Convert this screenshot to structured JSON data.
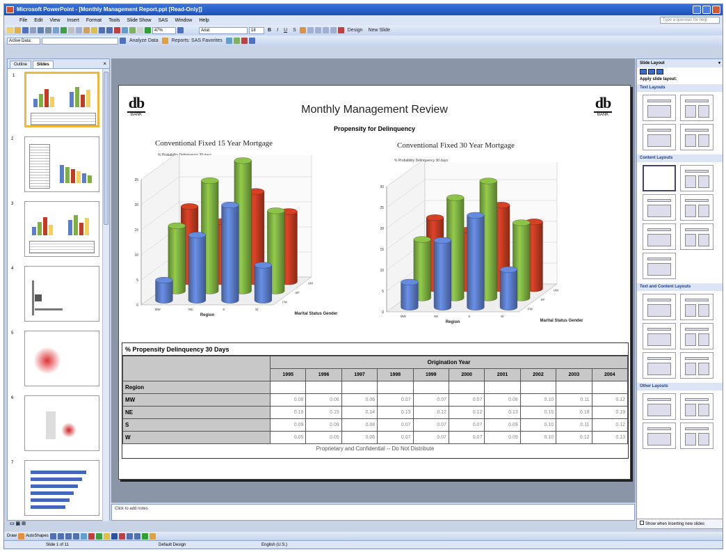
{
  "window": {
    "title": "Microsoft PowerPoint - [Monthly Management Report.ppt [Read-Only]]"
  },
  "menu": [
    "File",
    "Edit",
    "View",
    "Insert",
    "Format",
    "Tools",
    "Slide Show",
    "SAS",
    "Window",
    "Help"
  ],
  "help_box": "Type a question for help",
  "toolbar": {
    "zoom": "47%",
    "font": "Arial",
    "font_size": "18",
    "design_label": "Design",
    "new_slide_label": "New Slide",
    "active_data": "Active Data:",
    "analyze_label": "Analyze Data",
    "reports_label": "Reports: SAS Favorites"
  },
  "left_pane": {
    "tabs": [
      "Outline",
      "Slides"
    ],
    "thumb_numbers": [
      "1",
      "2",
      "3",
      "4",
      "5",
      "6",
      "7"
    ]
  },
  "slide": {
    "logo_text": "db",
    "logo_sub": "BANK",
    "title": "Monthly Management Review",
    "subtitle": "Propensity for Delinquency",
    "footer": "Proprietary and Confidential -- Do Not Distribute"
  },
  "colors": {
    "blue": "#5b7ec9",
    "green": "#7fb142",
    "red": "#c23b22",
    "yellow": "#f5cf5b"
  },
  "chart_data": [
    {
      "type": "bar3d-cylinder",
      "title": "Conventional Fixed 15 Year Mortgage",
      "ylabel": "% Probability Delinquency 30 days",
      "xlabel": "Region",
      "zlabel": "Marital Status Gender",
      "categories": [
        "MW",
        "NE",
        "S",
        "W"
      ],
      "depth_labels": [
        "FM",
        "SF",
        "UM"
      ],
      "y_ticks": [
        "0",
        "5",
        "10",
        "15",
        "20",
        "25"
      ],
      "ylim": [
        0,
        25
      ],
      "series": [
        {
          "values": [
            4,
            13,
            19,
            7
          ],
          "color": "blue"
        },
        {
          "values": [
            13,
            22,
            26,
            16
          ],
          "color": "green"
        },
        {
          "values": [
            15,
            12,
            18,
            14
          ],
          "color": "red"
        }
      ]
    },
    {
      "type": "bar3d-cylinder",
      "title": "Conventional Fixed 30 Year Mortgage",
      "ylabel": "% Probability Delinquency 30 days",
      "xlabel": "Region",
      "zlabel": "Marital Status Gender",
      "categories": [
        "MW",
        "NE",
        "S",
        "W"
      ],
      "depth_labels": [
        "FM",
        "SF",
        "UM"
      ],
      "y_ticks": [
        "0",
        "5",
        "10",
        "15",
        "20",
        "25",
        "30"
      ],
      "ylim": [
        0,
        30
      ],
      "series": [
        {
          "values": [
            6,
            16,
            22,
            9
          ],
          "color": "blue"
        },
        {
          "values": [
            14,
            24,
            28,
            18
          ],
          "color": "green"
        },
        {
          "values": [
            17,
            14,
            20,
            16
          ],
          "color": "red"
        }
      ]
    }
  ],
  "table": {
    "title": "% Propensity Delinquency 30 Days",
    "group_header": "Origination Year",
    "row_header": "Region",
    "years": [
      "1995",
      "1996",
      "1997",
      "1998",
      "1999",
      "2000",
      "2001",
      "2002",
      "2003",
      "2004"
    ],
    "rows": [
      {
        "region": "MW",
        "values": [
          "0.08",
          "0.06",
          "0.06",
          "0.07",
          "0.07",
          "0.07",
          "0.08",
          "0.10",
          "0.11",
          "0.12"
        ]
      },
      {
        "region": "NE",
        "values": [
          "0.16",
          "0.15",
          "0.14",
          "0.13",
          "0.12",
          "0.12",
          "0.13",
          "0.15",
          "0.18",
          "0.19"
        ]
      },
      {
        "region": "S",
        "values": [
          "0.09",
          "0.09",
          "0.08",
          "0.07",
          "0.07",
          "0.07",
          "0.09",
          "0.10",
          "0.11",
          "0.12"
        ]
      },
      {
        "region": "W",
        "values": [
          "0.05",
          "0.05",
          "0.06",
          "0.07",
          "0.07",
          "0.07",
          "0.09",
          "0.10",
          "0.12",
          "0.13"
        ]
      }
    ]
  },
  "notes": "Click to add notes",
  "right_pane": {
    "title": "Slide Layout",
    "apply": "Apply slide layout:",
    "sections": [
      "Text Layouts",
      "Content Layouts",
      "Text and Content Layouts",
      "Other Layouts"
    ],
    "show_when": "Show when inserting new slides"
  },
  "drawbar": {
    "draw": "Draw",
    "autoshapes": "AutoShapes"
  },
  "status": {
    "slide": "Slide 1 of 11",
    "design": "Default Design",
    "lang": "English (U.S.)"
  }
}
